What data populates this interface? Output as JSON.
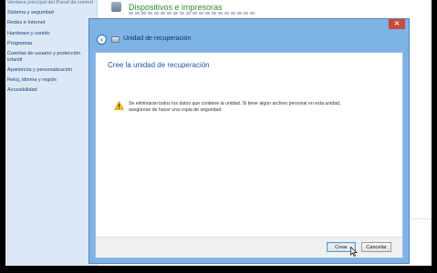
{
  "sidebar": {
    "items": [
      "Ventana principal del Panel de control",
      "Sistema y seguridad",
      "Redes e Internet",
      "Hardware y sonido",
      "Programas",
      "Cuentas de usuario y protección infantil",
      "Apariencia y personalización",
      "Reloj, idioma y región",
      "Accesibilidad"
    ]
  },
  "header": {
    "section_title": "Dispositivos e impresoras"
  },
  "dialog": {
    "title": "Unidad de recuperación",
    "heading": "Cree la unidad de recuperación",
    "warning": "Se eliminarán todos los datos que contiene la unidad. Si tiene algún archivo personal en esta unidad, asegúrese de hacer una copia de seguridad.",
    "buttons": {
      "create": "Crear",
      "cancel": "Cancelar"
    }
  },
  "icons": {
    "close": "close-icon",
    "back": "back-arrow-icon",
    "wizard": "recovery-drive-icon",
    "warning": "warning-icon",
    "cursor": "mouse-pointer-icon",
    "devices": "devices-printers-icon"
  },
  "colors": {
    "dialog_frame": "#7fb2e5",
    "heading": "#1c55a6",
    "close_button": "#c74a3c",
    "section_title": "#2b8a2b",
    "sidebar_bg": "#dbe8f6"
  }
}
